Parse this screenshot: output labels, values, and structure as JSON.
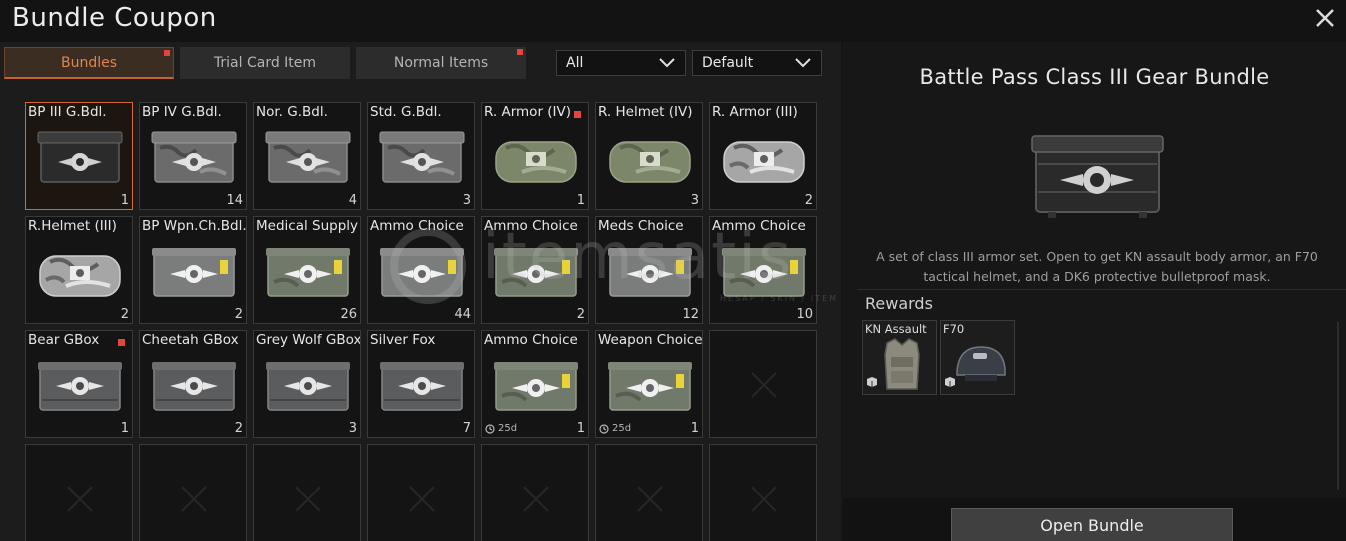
{
  "window": {
    "title": "Bundle Coupon"
  },
  "tabs": [
    {
      "label": "Bundles",
      "active": true,
      "alert": true
    },
    {
      "label": "Trial Card Item",
      "active": false,
      "alert": false
    },
    {
      "label": "Normal Items",
      "active": false,
      "alert": true
    }
  ],
  "filters": {
    "category": "All",
    "sort": "Default"
  },
  "items": [
    {
      "name": "BP III G.Bdl.",
      "count": "1",
      "icon": "black-crate",
      "selected": true
    },
    {
      "name": "BP IV G.Bdl.",
      "count": "14",
      "icon": "camo-crate"
    },
    {
      "name": "Nor. G.Bdl.",
      "count": "4",
      "icon": "camo-crate"
    },
    {
      "name": "Std. G.Bdl.",
      "count": "3",
      "icon": "camo-crate"
    },
    {
      "name": "R. Armor (IV)",
      "count": "1",
      "icon": "green-duffel",
      "alert": true
    },
    {
      "name": "R. Helmet (IV)",
      "count": "3",
      "icon": "green-duffel"
    },
    {
      "name": "R. Armor (III)",
      "count": "2",
      "icon": "white-duffel"
    },
    {
      "name": "R.Helmet (III)",
      "count": "2",
      "icon": "white-duffel"
    },
    {
      "name": "BP Wpn.Ch.Bdl.",
      "count": "2",
      "icon": "gray-case"
    },
    {
      "name": "Medical Supply",
      "count": "26",
      "icon": "green-case"
    },
    {
      "name": "Ammo Choice",
      "count": "44",
      "icon": "gray-case"
    },
    {
      "name": "Ammo Choice",
      "count": "2",
      "icon": "green-case"
    },
    {
      "name": "Meds Choice",
      "count": "12",
      "icon": "gray-case"
    },
    {
      "name": "Ammo Choice",
      "count": "10",
      "icon": "green-case"
    },
    {
      "name": "Bear GBox",
      "count": "1",
      "icon": "gray-box",
      "alert": true
    },
    {
      "name": "Cheetah GBox",
      "count": "2",
      "icon": "gray-box"
    },
    {
      "name": "Grey Wolf GBox",
      "count": "3",
      "icon": "gray-box"
    },
    {
      "name": "Silver Fox",
      "count": "7",
      "icon": "gray-box"
    },
    {
      "name": "Ammo Choice",
      "count": "1",
      "icon": "green-case",
      "timer": "25d"
    },
    {
      "name": "Weapon Choice",
      "count": "1",
      "icon": "green-case",
      "timer": "25d"
    }
  ],
  "detail": {
    "title": "Battle Pass Class III Gear Bundle",
    "description": "A set of class III armor set. Open to get KN assault body armor, an F70 tactical helmet, and a DK6 protective bulletproof mask.",
    "rewards_label": "Rewards",
    "rewards": [
      {
        "name": "KN Assault",
        "icon": "body-armor-icon"
      },
      {
        "name": "F70",
        "icon": "helmet-icon"
      }
    ],
    "open_button": "Open Bundle"
  },
  "watermark": {
    "text": "itemsatis",
    "sub": "HESAP / SKIN / ITEM / "
  }
}
